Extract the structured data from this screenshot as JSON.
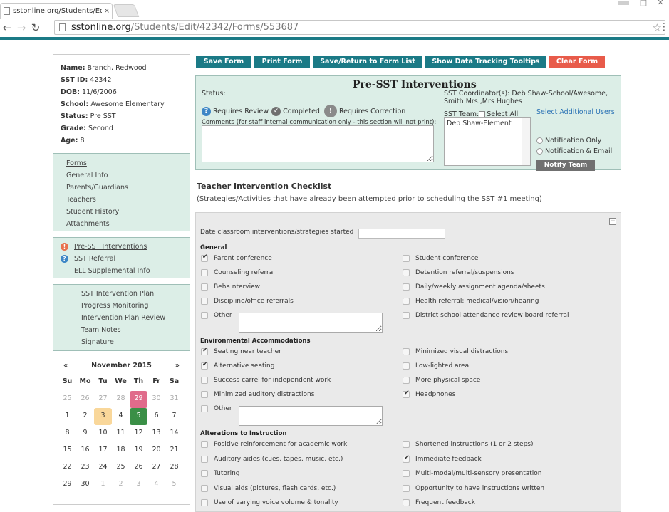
{
  "browser": {
    "tab_title": "sstonline.org/Students/Ed",
    "tab_close": "×",
    "url_host": "sstonline.org",
    "url_path": "/Students/Edit/42342/Forms/553687"
  },
  "student": {
    "name_label": "Name:",
    "name": "Branch, Redwood",
    "id_label": "SST ID:",
    "id": "42342",
    "dob_label": "DOB:",
    "dob": "11/6/2006",
    "school_label": "School:",
    "school": "Awesome Elementary",
    "status_label": "Status:",
    "status": "Pre SST",
    "grade_label": "Grade:",
    "grade": "Second",
    "age_label": "Age:",
    "age": "8"
  },
  "nav": {
    "items": [
      "Forms",
      "General Info",
      "Parents/Guardians",
      "Teachers",
      "Student History",
      "Attachments"
    ]
  },
  "forms_list": {
    "items": [
      "Pre-SST Interventions",
      "SST Referral",
      "ELL Supplemental Info"
    ]
  },
  "plan_list": {
    "items": [
      "SST Intervention Plan",
      "Progress Monitoring",
      "Intervention Plan Review",
      "Team Notes",
      "Signature"
    ]
  },
  "calendar": {
    "prev": "«",
    "next": "»",
    "month": "November 2015",
    "dow": [
      "Su",
      "Mo",
      "Tu",
      "We",
      "Th",
      "Fr",
      "Sa"
    ],
    "weeks": [
      [
        "25",
        "26",
        "27",
        "28",
        "29",
        "30",
        "31"
      ],
      [
        "1",
        "2",
        "3",
        "4",
        "5",
        "6",
        "7"
      ],
      [
        "8",
        "9",
        "10",
        "11",
        "12",
        "13",
        "14"
      ],
      [
        "15",
        "16",
        "17",
        "18",
        "19",
        "20",
        "21"
      ],
      [
        "22",
        "23",
        "24",
        "25",
        "26",
        "27",
        "28"
      ],
      [
        "29",
        "30",
        "1",
        "2",
        "3",
        "4",
        "5"
      ]
    ]
  },
  "actions": {
    "save": "Save Form",
    "print": "Print Form",
    "save_return": "Save/Return to Form List",
    "tooltips": "Show Data Tracking Tooltips",
    "clear": "Clear Form"
  },
  "pre_sst": {
    "title": "Pre-SST Interventions",
    "status_label": "Status:",
    "requires_review": "Requires Review",
    "completed": "Completed",
    "requires_correction": "Requires Correction",
    "comments_label": "Comments (for staff internal communication only - this section will not print):",
    "coordinator": "SST Coordinator(s): Deb Shaw-School/Awesome, Smith Mrs.,Mrs Hughes",
    "team_label": "SST Team:",
    "select_all": "Select All",
    "select_additional": "Select Additional Users",
    "team_members": [
      "Deb Shaw-Element"
    ],
    "notification_only": "Notification Only",
    "notification_email": "Notification & Email",
    "notify_team": "Notify Team"
  },
  "checklist": {
    "title": "Teacher Intervention Checklist",
    "subtitle": "(Strategies/Activities that have already been attempted prior to scheduling the SST #1 meeting)",
    "collapse": "−",
    "date_label": "Date classroom interventions/strategies started",
    "general_title": "General",
    "general": [
      {
        "label": "Parent conference",
        "checked": true
      },
      {
        "label": "Student conference",
        "checked": false
      },
      {
        "label": "Counseling referral",
        "checked": false
      },
      {
        "label": "Detention referral/suspensions",
        "checked": false
      },
      {
        "label": "Beha                nterview",
        "checked": false
      },
      {
        "label": "Daily/weekly assignment agenda/sheets",
        "checked": false
      },
      {
        "label": "Discipline/office referrals",
        "checked": false
      },
      {
        "label": "Health referral: medical/vision/hearing",
        "checked": false
      },
      {
        "label": "Other",
        "checked": false
      },
      {
        "label": "District school attendance review board referral",
        "checked": false
      }
    ],
    "env_title": "Environmental Accommodations",
    "env": [
      {
        "label": "Seating near teacher",
        "checked": true
      },
      {
        "label": "Minimized visual distractions",
        "checked": false
      },
      {
        "label": "Alternative seating",
        "checked": true
      },
      {
        "label": "Low-lighted area",
        "checked": false
      },
      {
        "label": "Success carrel for independent work",
        "checked": false
      },
      {
        "label": "More physical space",
        "checked": false
      },
      {
        "label": "Minimized auditory distractions",
        "checked": false
      },
      {
        "label": "Headphones",
        "checked": true
      },
      {
        "label": "Other",
        "checked": false
      }
    ],
    "alt_title": "Alterations to Instruction",
    "alt": [
      {
        "label": "Positive reinforcement for academic work",
        "checked": false
      },
      {
        "label": "Shortened instructions (1 or 2 steps)",
        "checked": false
      },
      {
        "label": "Auditory aides (cues, tapes, music, etc.)",
        "checked": false
      },
      {
        "label": "Immediate feedback",
        "checked": true
      },
      {
        "label": "Tutoring",
        "checked": false
      },
      {
        "label": "Multi-modal/multi-sensory presentation",
        "checked": false
      },
      {
        "label": "Visual aids (pictures, flash cards, etc.)",
        "checked": false
      },
      {
        "label": "Opportunity to have instructions written",
        "checked": false
      },
      {
        "label": "Use of varying voice volume & tonality",
        "checked": false
      },
      {
        "label": "Frequent feedback",
        "checked": false
      }
    ]
  }
}
